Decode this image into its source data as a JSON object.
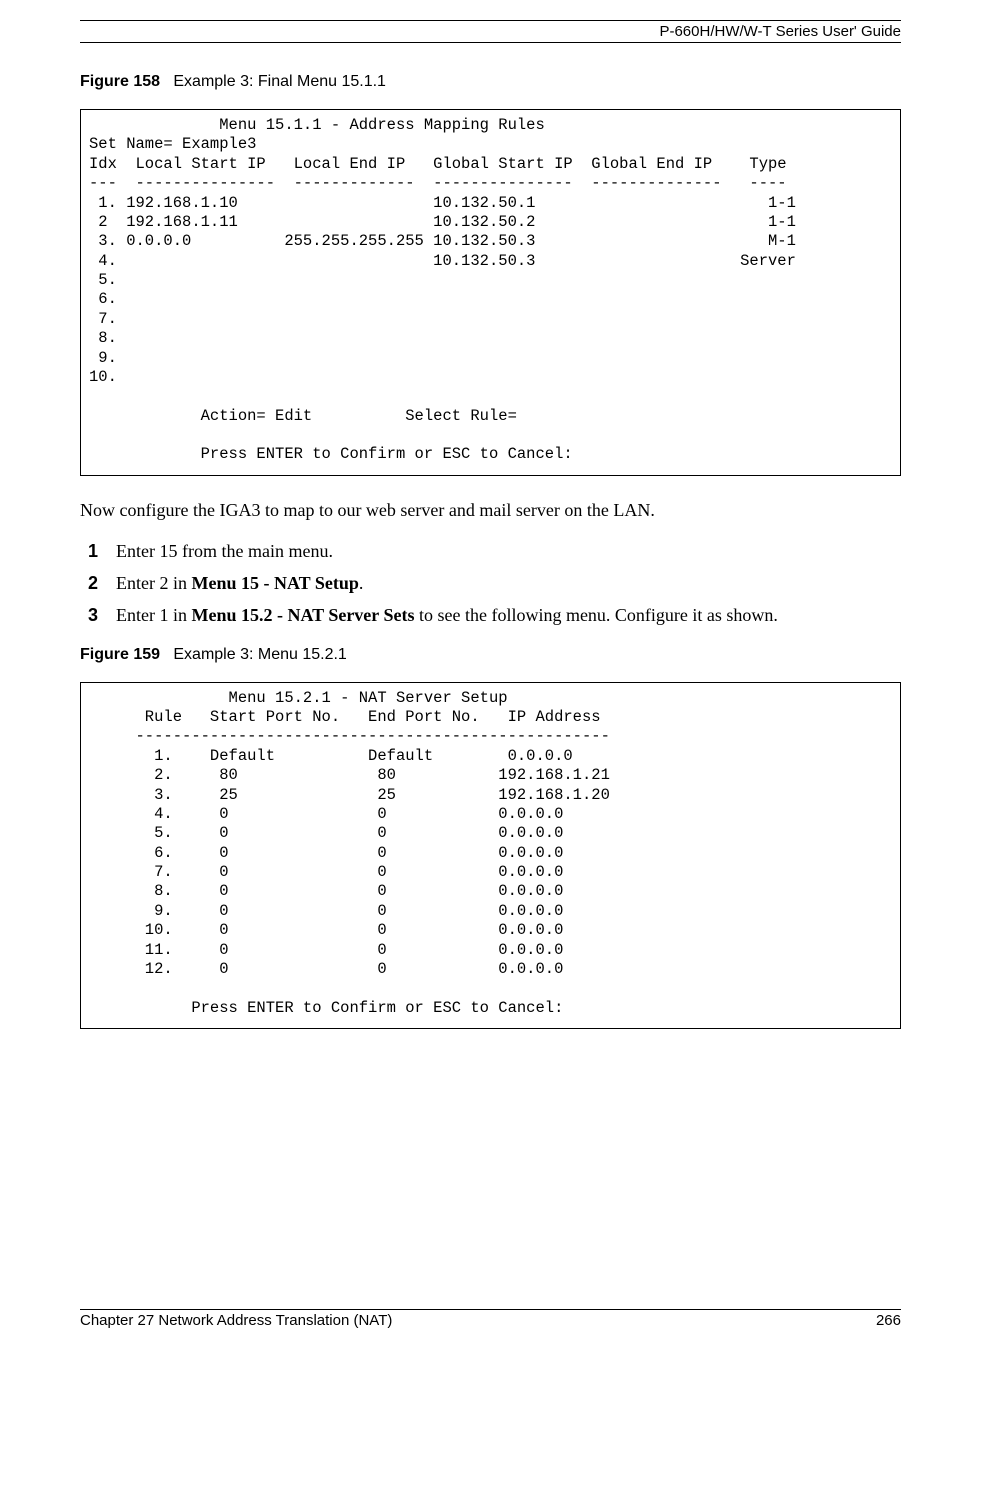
{
  "header": {
    "guide_title": "P-660H/HW/W-T Series User' Guide"
  },
  "figure158": {
    "label": "Figure 158",
    "caption": "Example 3: Final Menu 15.1.1",
    "terminal": "              Menu 15.1.1 - Address Mapping Rules\nSet Name= Example3\nIdx  Local Start IP   Local End IP   Global Start IP  Global End IP    Type\n---  ---------------  -------------  ---------------  --------------   ----\n 1. 192.168.1.10                     10.132.50.1                         1-1\n 2  192.168.1.11                     10.132.50.2                         1-1\n 3. 0.0.0.0          255.255.255.255 10.132.50.3                         M-1\n 4.                                  10.132.50.3                      Server\n 5.\n 6.\n 7.\n 8.\n 9.\n10.\n\n            Action= Edit          Select Rule=\n\n            Press ENTER to Confirm or ESC to Cancel:"
  },
  "body1": "Now configure the IGA3 to map to our web server and mail server on the LAN.",
  "steps": {
    "s1": {
      "num": "1",
      "text": "Enter 15 from the main menu."
    },
    "s2": {
      "num": "2",
      "pre": "Enter 2 in ",
      "bold": "Menu 15 - NAT Setup",
      "post": "."
    },
    "s3": {
      "num": "3",
      "pre": "Enter 1 in ",
      "bold": "Menu 15.2 - NAT Server Sets",
      "post": " to see the following menu. Configure it as shown."
    }
  },
  "figure159": {
    "label": "Figure 159",
    "caption": "Example 3: Menu 15.2.1",
    "terminal": "               Menu 15.2.1 - NAT Server Setup\n      Rule   Start Port No.   End Port No.   IP Address\n     ---------------------------------------------------\n       1.    Default          Default        0.0.0.0\n       2.     80               80           192.168.1.21\n       3.     25               25           192.168.1.20\n       4.     0                0            0.0.0.0\n       5.     0                0            0.0.0.0\n       6.     0                0            0.0.0.0\n       7.     0                0            0.0.0.0\n       8.     0                0            0.0.0.0\n       9.     0                0            0.0.0.0\n      10.     0                0            0.0.0.0\n      11.     0                0            0.0.0.0\n      12.     0                0            0.0.0.0\n\n           Press ENTER to Confirm or ESC to Cancel:"
  },
  "footer": {
    "chapter": "Chapter 27 Network Address Translation (NAT)",
    "page": "266"
  }
}
